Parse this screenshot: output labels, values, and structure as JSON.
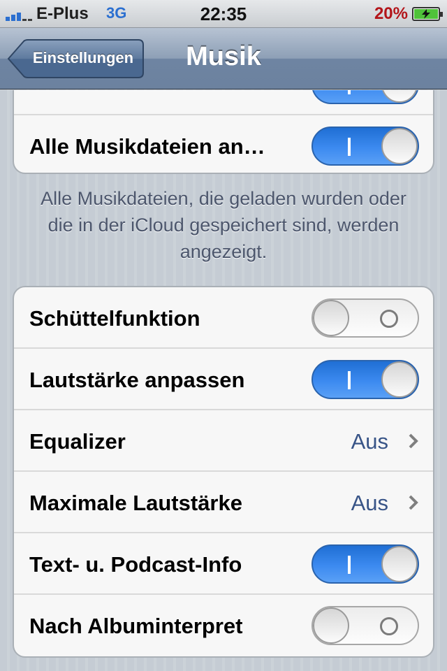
{
  "status_bar": {
    "carrier": "E-Plus",
    "network": "3G",
    "time": "22:35",
    "battery_percent": "20%",
    "battery_icon": "battery-charging-icon",
    "signal_icon": "signal-bars-icon"
  },
  "nav": {
    "back_label": "Einstellungen",
    "title": "Musik"
  },
  "group1": {
    "rows": [
      {
        "title": "Alle Musikdateien an…",
        "switch": true
      }
    ],
    "footer": "Alle Musikdateien, die geladen wurden oder die in der iCloud gespeichert sind, werden angezeigt."
  },
  "group2": {
    "rows": [
      {
        "title": "Schüttelfunktion",
        "switch": false
      },
      {
        "title": "Lautstärke anpassen",
        "switch": true
      },
      {
        "title": "Equalizer",
        "detail": "Aus"
      },
      {
        "title": "Maximale Lautstärke",
        "detail": "Aus"
      },
      {
        "title": "Text- u. Podcast-Info",
        "switch": true
      },
      {
        "title": "Nach Albuminterpret",
        "switch": false
      }
    ]
  },
  "colors": {
    "switch_on": "#3c8af0",
    "detail_text": "#385487",
    "battery_text": "#b3151a"
  }
}
